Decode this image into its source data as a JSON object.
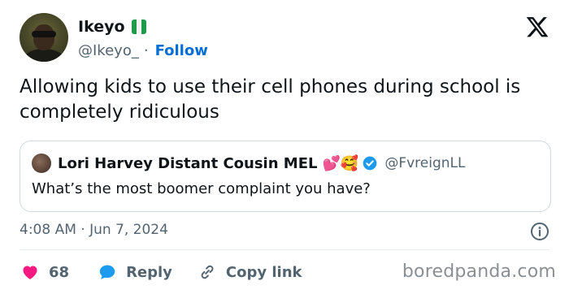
{
  "author": {
    "display_name": "Ikeyo",
    "handle": "@Ikeyo_",
    "separator": "·",
    "follow_label": "Follow"
  },
  "tweet": {
    "text": "Allowing kids to use their cell phones during school is completely ridiculous",
    "timestamp": "4:08 AM · Jun 7, 2024"
  },
  "quote": {
    "display_name": "Lori Harvey Distant Cousin MEL",
    "emoji": "💕🥰",
    "handle": "@FvreignLL",
    "text": "What’s the most boomer complaint you have?"
  },
  "actions": {
    "like_count": "68",
    "reply_label": "Reply",
    "copy_link_label": "Copy link"
  },
  "watermark": "boredpanda.com",
  "colors": {
    "link_blue": "#006fd6",
    "heart_red": "#f91880",
    "reply_blue": "#1d9bf0",
    "verified_blue": "#1d9bf0",
    "muted_text": "#536471"
  },
  "icons": {
    "flag": "nigeria-flag-icon",
    "platform": "x-logo-icon",
    "info": "info-icon",
    "like": "heart-icon",
    "reply": "speech-bubble-icon",
    "copy_link": "link-icon",
    "verified": "verified-badge-icon"
  }
}
